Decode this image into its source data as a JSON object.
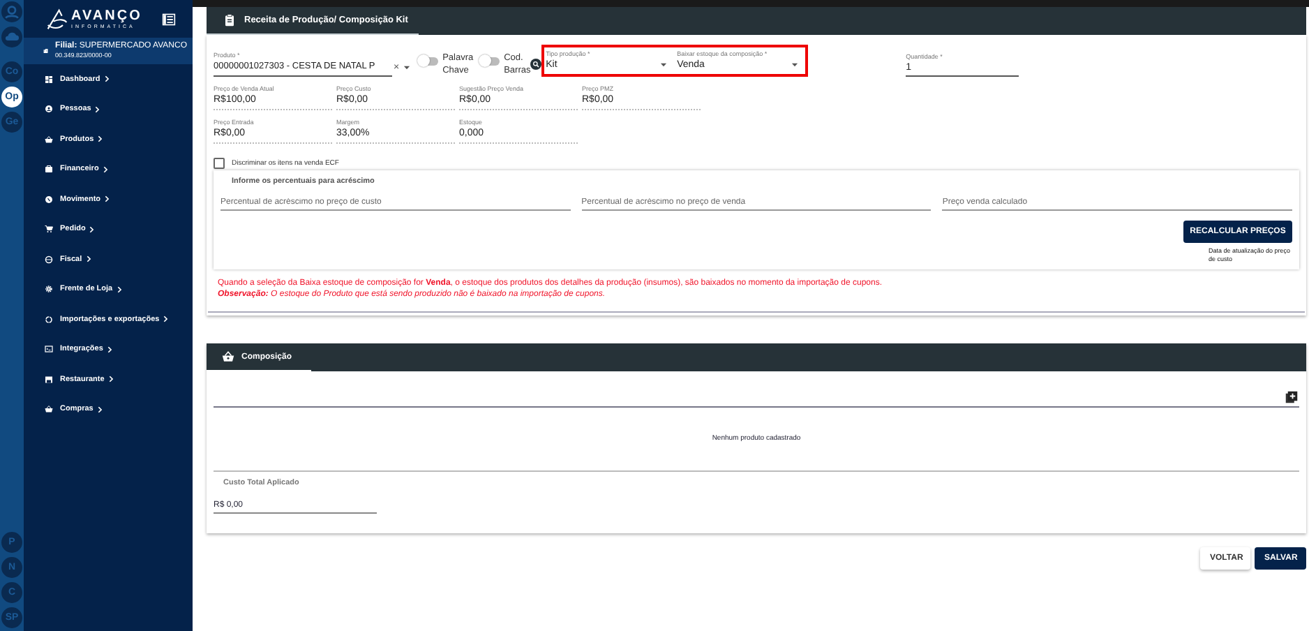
{
  "rail": {
    "items": [
      {
        "label": "Co",
        "selected": false
      },
      {
        "label": "Op",
        "selected": true
      },
      {
        "label": "Ge",
        "selected": false
      }
    ],
    "bottom_items": [
      {
        "label": "P"
      },
      {
        "label": "N"
      },
      {
        "label": "C"
      },
      {
        "label": "SP"
      }
    ]
  },
  "sidebar": {
    "logo": {
      "name": "AVANÇO",
      "tagline": "INFORMATICA"
    },
    "branch": {
      "text": "**Filial:** SUPERMERCADO AVANCO",
      "cnpj": "00.349.823/0000-00"
    },
    "items": [
      {
        "label": "Dashboard"
      },
      {
        "label": "Pessoas"
      },
      {
        "label": "Produtos"
      },
      {
        "label": "Financeiro"
      },
      {
        "label": "Movimento"
      },
      {
        "label": "Pedido"
      },
      {
        "label": "Fiscal"
      },
      {
        "label": "Frente de Loja"
      },
      {
        "label": "Importações e exportações"
      },
      {
        "label": "Integrações"
      },
      {
        "label": "Restaurante"
      },
      {
        "label": "Compras"
      }
    ]
  },
  "page_tab": {
    "title": "Receita de Produção/ Composição Kit",
    "selected": true
  },
  "product": {
    "label": "Produto *",
    "value": "00000001027303 - CESTA DE NATAL P",
    "clear": "×"
  },
  "toggles": [
    {
      "label": "Palavra Chave",
      "on": false
    },
    {
      "label": "Cod. Barras",
      "on": false
    }
  ],
  "highlighted_selects": {
    "highlighted": true,
    "fields": [
      {
        "label": "Tipo produção *",
        "value": "Kit"
      },
      {
        "label": "Baixar estoque da composição *",
        "value": "Venda"
      }
    ]
  },
  "quantity": {
    "label": "Quantidade *",
    "value": "1"
  },
  "price_rows": [
    [
      {
        "label": "Preço de Venda Atual",
        "value": "R$100,00"
      },
      {
        "label": "Preço Custo",
        "value": "R$0,00"
      },
      {
        "label": "Sugestão Preço Venda",
        "value": "R$0,00"
      },
      {
        "label": "Preço PMZ",
        "value": "R$0,00"
      }
    ],
    [
      {
        "label": "Preço Entrada",
        "value": "R$0,00"
      },
      {
        "label": "Margem",
        "value": "33,00%"
      },
      {
        "label": "Estoque",
        "value": "0,000"
      }
    ]
  ],
  "ecf_checkbox": {
    "label": "Discriminar os itens na venda ECF",
    "checked": false
  },
  "markup": {
    "title": "Informe os percentuais para acréscimo",
    "fields": [
      {
        "placeholder": "Percentual de acréscimo no preço de custo"
      },
      {
        "placeholder": "Percentual de acréscimo no preço de venda"
      },
      {
        "placeholder": "Preço venda calculado"
      }
    ],
    "button": "RECALCULAR PREÇOS",
    "note": "Data de atualização do preço de custo"
  },
  "notice": [
    "Quando a seleção da Baixa estoque de composição for **Venda**, o estoque dos produtos dos detalhes da produção (insumos), são baixados no momento da importação de cupons.",
    "**Observação:** O estoque do Produto que está sendo produzido não é baixado na importação de cupons."
  ],
  "composition": {
    "tab": {
      "title": "Composição",
      "selected": true
    },
    "empty": "Nenhum produto cadastrado",
    "total_label": "Custo Total Aplicado",
    "total_value": "R$ 0,00"
  },
  "buttons": [
    {
      "label": "VOLTAR",
      "kind": "secondary"
    },
    {
      "label": "SALVAR",
      "kind": "primary"
    }
  ]
}
